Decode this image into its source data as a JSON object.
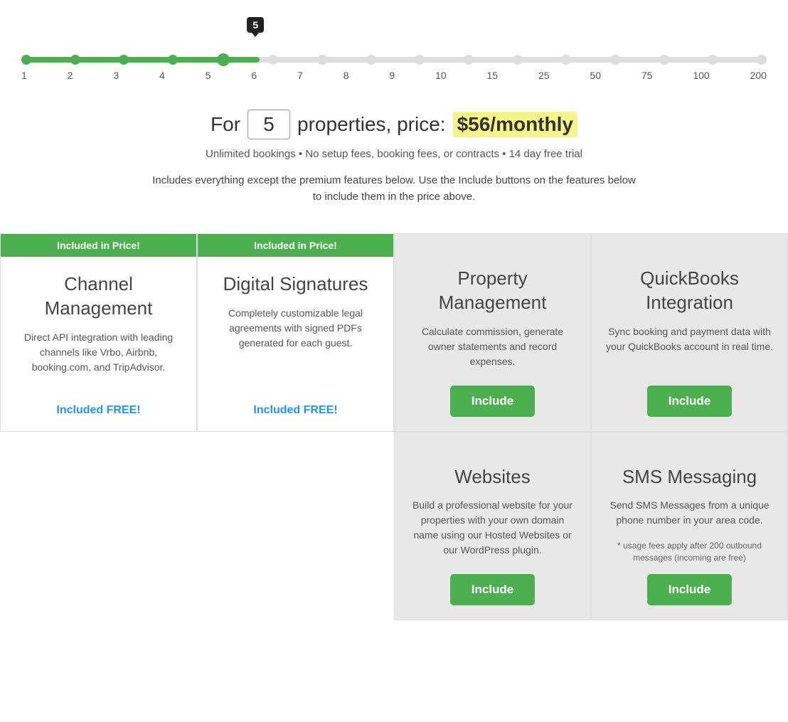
{
  "slider": {
    "tooltip": "5",
    "values": [
      "1",
      "2",
      "3",
      "4",
      "5",
      "6",
      "7",
      "8",
      "9",
      "10",
      "15",
      "25",
      "50",
      "75",
      "100",
      "200"
    ],
    "active_index": 4
  },
  "pricing": {
    "label_for": "For",
    "value": "5",
    "label_properties": "properties, price:",
    "price": "$56",
    "period": "/monthly",
    "subtitle": "Unlimited bookings • No setup fees, booking fees, or contracts • 14 day free trial",
    "note": "Includes everything except the premium features below.  Use the Include buttons on the features below to include them in the price above."
  },
  "features": [
    {
      "id": "channel-management",
      "header": "Included in Price!",
      "has_header": true,
      "title": "Channel Management",
      "desc": "Direct API integration with leading channels like Vrbo, Airbnb, booking.com, and TripAdvisor.",
      "cta_type": "link",
      "cta_label": "Included FREE!",
      "bg": "green"
    },
    {
      "id": "digital-signatures",
      "header": "Included in Price!",
      "has_header": true,
      "title": "Digital Signatures",
      "desc": "Completely customizable legal agreements with signed PDFs generated for each guest.",
      "cta_type": "link",
      "cta_label": "Included FREE!",
      "bg": "green"
    },
    {
      "id": "property-management",
      "header": null,
      "has_header": false,
      "title": "Property Management",
      "desc": "Calculate commission, generate owner statements and record expenses.",
      "cta_type": "button",
      "cta_label": "Include",
      "bg": "gray"
    },
    {
      "id": "quickbooks-integration",
      "header": null,
      "has_header": false,
      "title": "QuickBooks Integration",
      "desc": "Sync booking and payment data with your QuickBooks account in real time.",
      "cta_type": "button",
      "cta_label": "Include",
      "bg": "gray"
    }
  ],
  "features_row2": [
    {
      "id": "websites",
      "title": "Websites",
      "desc": "Build a professional website for your properties with your own domain name using our Hosted Websites or our WordPress plugin.",
      "cta_label": "Include",
      "usage_note": null
    },
    {
      "id": "sms-messaging",
      "title": "SMS Messaging",
      "desc": "Send SMS Messages from a unique phone number in your area code.",
      "usage_note": "* usage fees apply after 200 outbound messages (incoming are free)",
      "cta_label": "Include"
    }
  ]
}
